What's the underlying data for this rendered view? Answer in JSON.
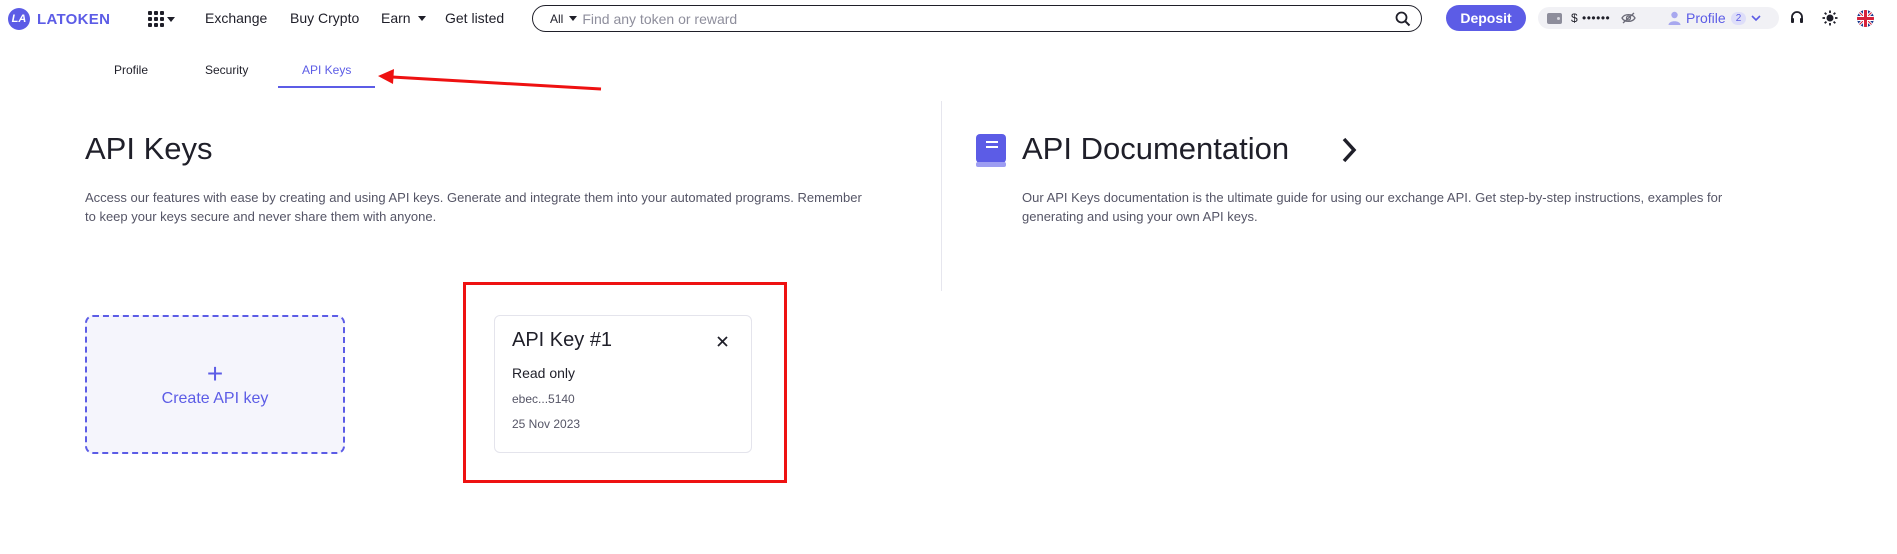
{
  "header": {
    "brand": "LATOKEN",
    "nav": [
      "Exchange",
      "Buy Crypto",
      "Earn",
      "Get listed"
    ],
    "search": {
      "filter": "All",
      "placeholder": "Find any token or reward"
    },
    "deposit_label": "Deposit",
    "wallet_balance": "$ ••••••",
    "profile_label": "Profile",
    "profile_badge": "2"
  },
  "tabs": [
    {
      "label": "Profile",
      "active": false
    },
    {
      "label": "Security",
      "active": false
    },
    {
      "label": "API Keys",
      "active": true
    }
  ],
  "api_keys": {
    "title": "API Keys",
    "description_line1": "Access our features with ease by creating and using API keys. Generate and integrate them into your automated programs. Remember",
    "description_line2": "to keep your keys secure and never share them with anyone.",
    "create_label": "Create API key",
    "keys": [
      {
        "name": "API Key #1",
        "permission": "Read only",
        "key_masked": "ebec...5140",
        "created": "25 Nov 2023"
      }
    ]
  },
  "api_docs": {
    "title": "API Documentation",
    "description_line1": "Our API Keys documentation is the ultimate guide for using our exchange API. Get step-by-step instructions, examples for",
    "description_line2": "generating and using your own API keys."
  },
  "colors": {
    "accent": "#5c5ce6",
    "annotation": "#ee1111",
    "text": "#1f1f29",
    "muted": "#555566"
  },
  "icons": [
    "apps-grid-icon",
    "search-icon",
    "wallet-icon",
    "eye-off-icon",
    "user-icon",
    "chevron-down-icon",
    "headset-icon",
    "sun-icon",
    "uk-flag-icon",
    "book-icon",
    "chevron-right-icon",
    "close-icon"
  ]
}
